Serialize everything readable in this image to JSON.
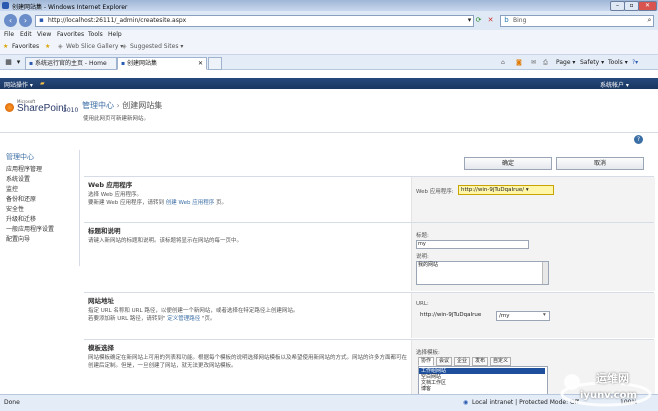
{
  "browser": {
    "title": "创建网站集 - Windows Internet Explorer",
    "url": "http://localhost:26111/_admin/createsite.aspx",
    "search_placeholder": "Bing",
    "menu": [
      "File",
      "Edit",
      "View",
      "Favorites",
      "Tools",
      "Help"
    ],
    "favorites_label": "Favorites",
    "fav_links": [
      "Web Slice Gallery ▾",
      "Suggested Sites ▾"
    ],
    "tabs": [
      "系统运行官的主页 - Home",
      "创建网站集"
    ],
    "tools": [
      "Page ▾",
      "Safety ▾",
      "Tools ▾"
    ],
    "status_left": "Done",
    "status_zone": "Local intranet | Protected Mode: Off",
    "zoom": "100%"
  },
  "sp": {
    "site_actions": "网站操作 ▾",
    "user": "系统帐户 ▾",
    "logo_ms": "Microsoft",
    "logo_text": "SharePoint",
    "logo_ver": "2010",
    "crumb_root": "管理中心",
    "crumb_sep": "›",
    "crumb_current": "创建网站集",
    "subtitle": "使用此网页可新建新网站。",
    "help": "?",
    "nav_header": "管理中心",
    "nav_items": [
      "应用程序管理",
      "系统设置",
      "监控",
      "备份和还原",
      "安全性",
      "升级和迁移",
      "一般应用程序设置",
      "配置向导"
    ],
    "ok": "确定",
    "cancel": "取消",
    "webapp": {
      "title": "Web 应用程序",
      "desc1": "选择 Web 应用程序。",
      "desc2_pre": "要新建 Web 应用程序，请转到",
      "desc2_link": "创建 Web 应用程序",
      "desc2_post": "页。",
      "label": "Web 应用程序:",
      "value": "http://win-9jTuDqaIrue/ ▾"
    },
    "titledesc": {
      "title": "标题和说明",
      "desc": "请键入新网站的标题和说明。该标题将显示在网站的每一页中。",
      "title_label": "标题:",
      "title_value": "my",
      "desc_label": "说明:",
      "desc_value": "我的网站"
    },
    "address": {
      "title": "网站地址",
      "desc1": "指定 URL 名称和 URL 路径，以便创建一个新网站，或者选择在特定路径上创建网站。",
      "desc2_pre": "若要添加新 URL 路径，请转到\"",
      "desc2_link": "定义管理路径",
      "desc2_post": "\"页。",
      "label": "URL:",
      "prefix": "http://win-9jTuDqaIrue",
      "path": "/my"
    },
    "template": {
      "title": "模板选择",
      "desc": "网站模板确定在新网站上可用的列表和功能。根据每个模板的说明选择网站模板以及希望使用新网站的方式。网站的许多方面都可在创建后定制。但是，一旦创建了网站，就无法更改网站模板。",
      "label": "选择模板:",
      "tabs": [
        "协作",
        "会议",
        "企业",
        "发布",
        "自定义"
      ],
      "items": [
        "工作组网站",
        "空白网站",
        "文档工作区",
        "博客"
      ]
    }
  },
  "watermark": {
    "brand": "运维网",
    "url": "iyunv.com"
  },
  "colors": {
    "ribbon": "#1a3660",
    "link": "#3b6ea5",
    "selected_template": "#1e4f9c",
    "webapp_select": "#fff6a8"
  }
}
